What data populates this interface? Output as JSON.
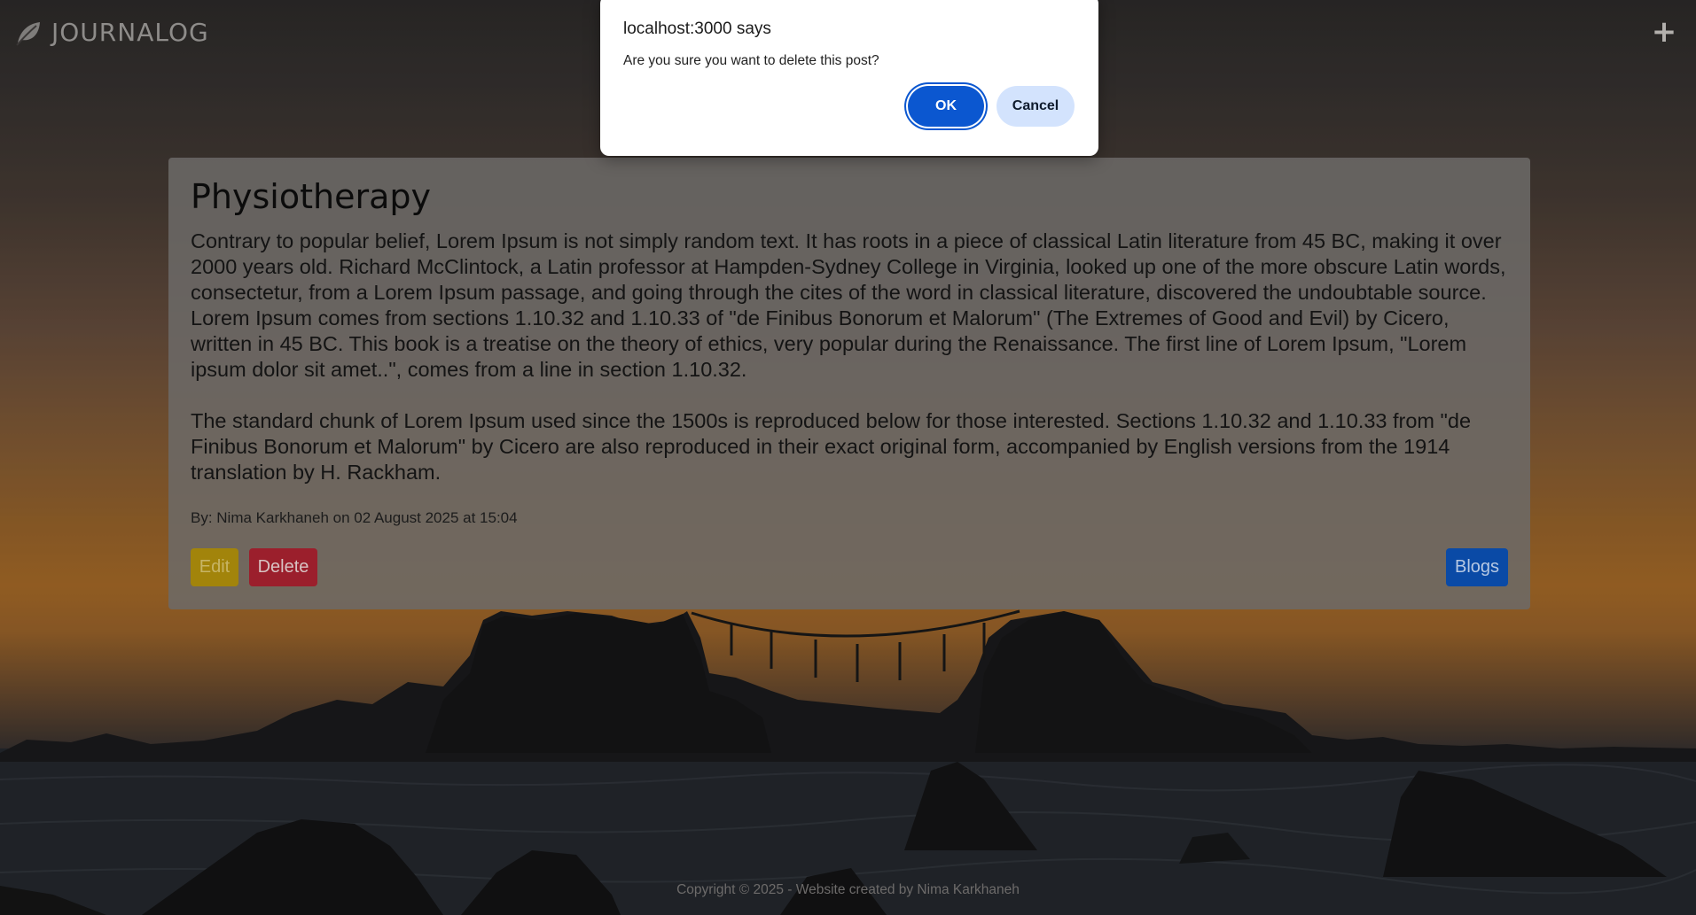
{
  "navbar": {
    "brand_icon": "leaf-icon",
    "brand_name": "JOURNALOG",
    "add_icon": "plus-icon",
    "add_label": "+"
  },
  "post": {
    "title": "Physiotherapy",
    "paragraphs": [
      "Contrary to popular belief, Lorem Ipsum is not simply random text. It has roots in a piece of classical Latin literature from 45 BC, making it over 2000 years old. Richard McClintock, a Latin professor at Hampden-Sydney College in Virginia, looked up one of the more obscure Latin words, consectetur, from a Lorem Ipsum passage, and going through the cites of the word in classical literature, discovered the undoubtable source. Lorem Ipsum comes from sections 1.10.32 and 1.10.33 of \"de Finibus Bonorum et Malorum\" (The Extremes of Good and Evil) by Cicero, written in 45 BC. This book is a treatise on the theory of ethics, very popular during the Renaissance. The first line of Lorem Ipsum, \"Lorem ipsum dolor sit amet..\", comes from a line in section 1.10.32.",
      "The standard chunk of Lorem Ipsum used since the 1500s is reproduced below for those interested. Sections 1.10.32 and 1.10.33 from \"de Finibus Bonorum et Malorum\" by Cicero are also reproduced in their exact original form, accompanied by English versions from the 1914 translation by H. Rackham."
    ],
    "meta": "By: Nima Karkhaneh on 02 August 2025 at 15:04",
    "edit_label": "Edit",
    "delete_label": "Delete",
    "blogs_label": "Blogs"
  },
  "footer": {
    "text": "Copyright © 2025 - Website created by Nima Karkhaneh"
  },
  "dialog": {
    "title": "localhost:3000 says",
    "message": "Are you sure you want to delete this post?",
    "ok_label": "OK",
    "cancel_label": "Cancel"
  },
  "colors": {
    "ok_button": "#0b57d0",
    "cancel_button": "#d3e3fd",
    "edit_button": "#a2840b",
    "delete_button": "#9b1f2c",
    "blogs_button": "#0a4aa6"
  }
}
